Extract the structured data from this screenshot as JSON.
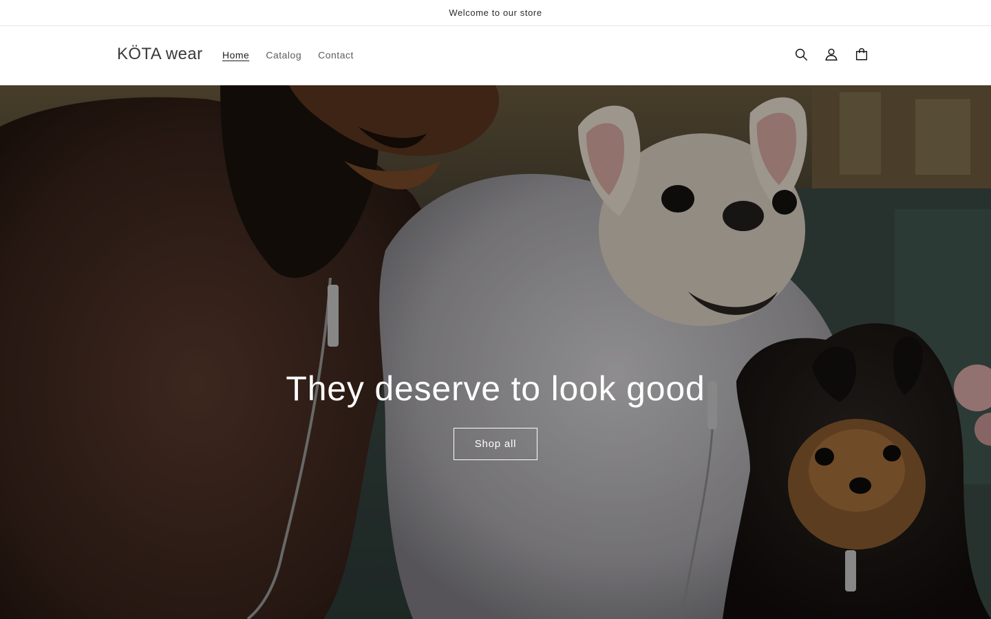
{
  "announcement": {
    "text": "Welcome to our store"
  },
  "header": {
    "logo": "KÖTA wear",
    "nav": [
      {
        "label": "Home",
        "active": true
      },
      {
        "label": "Catalog",
        "active": false
      },
      {
        "label": "Contact",
        "active": false
      }
    ],
    "icons": [
      "search-icon",
      "account-icon",
      "cart-icon"
    ]
  },
  "hero": {
    "title": "They deserve to look good",
    "button_label": "Shop all"
  },
  "colors": {
    "text": "#121212",
    "nav_muted": "#5c5c5c",
    "divider": "#e6e6e6",
    "hero_text": "#ffffff"
  }
}
